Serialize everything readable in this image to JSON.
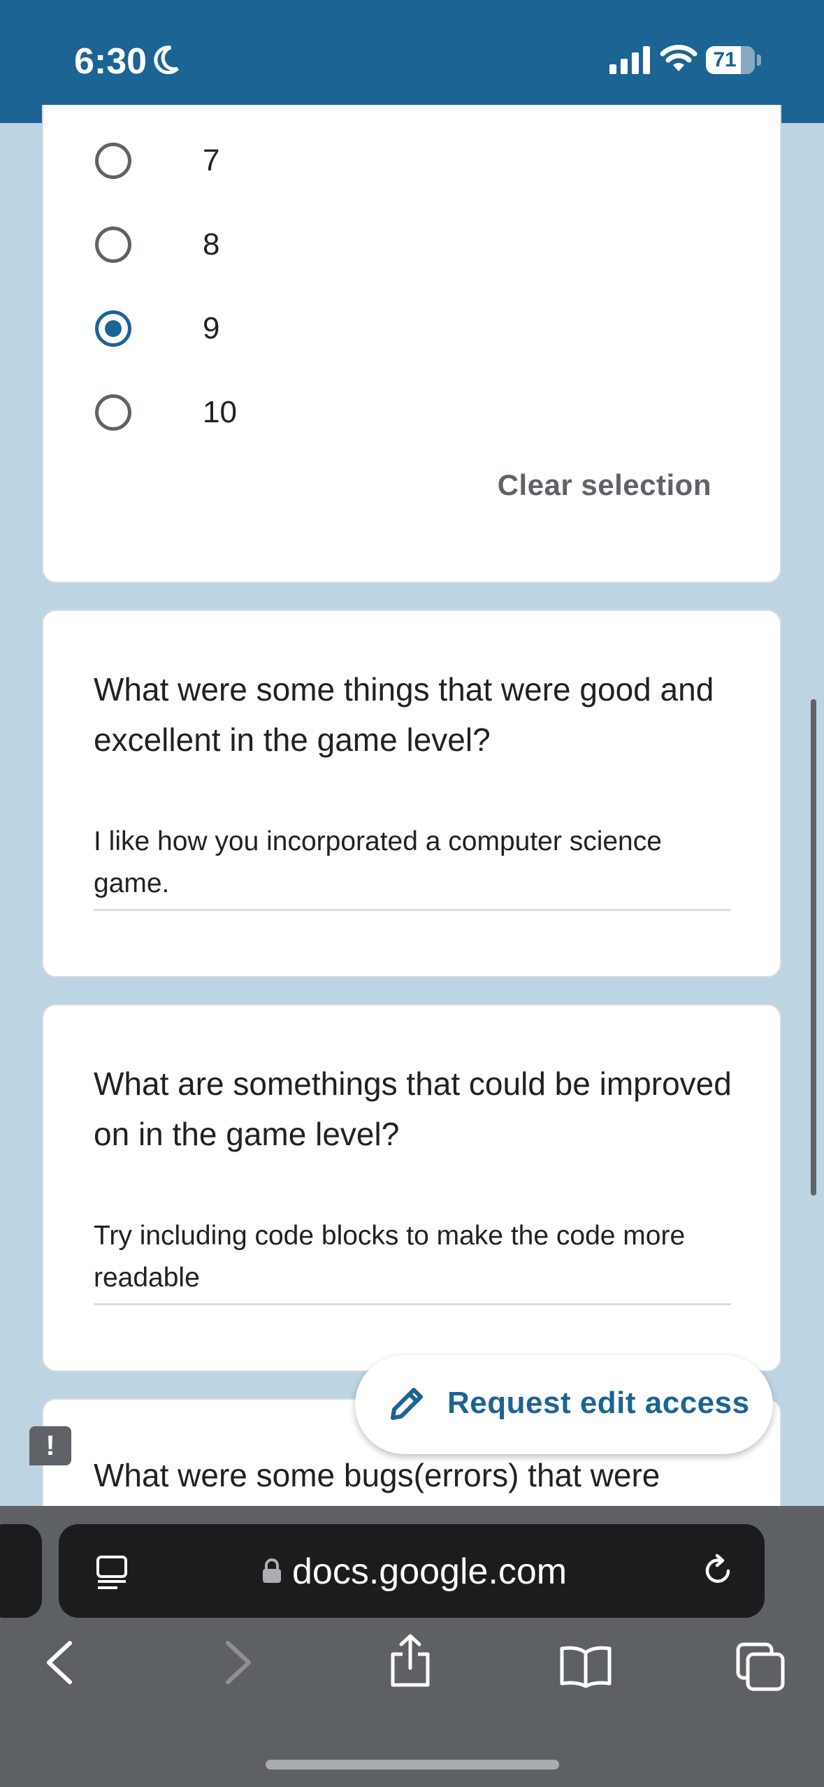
{
  "status_bar": {
    "time": "6:30",
    "battery": "71",
    "icons": [
      "moon-icon",
      "signal-icon",
      "wifi-icon",
      "battery-icon"
    ]
  },
  "rating_question": {
    "options": [
      "7",
      "8",
      "9",
      "10"
    ],
    "selected": "9",
    "clear_label": "Clear selection"
  },
  "questions": [
    {
      "question": "What were some things that were good and excellent in the game level?",
      "answer": "I like how you incorporated a computer science game."
    },
    {
      "question": "What are somethings that could be improved on in the game level?",
      "answer": "Try including code blocks to make the code more readable"
    },
    {
      "question": "What were some bugs(errors) that were"
    }
  ],
  "fab": {
    "label": "Request edit access",
    "icon": "pencil-icon"
  },
  "feedback_icon": "!",
  "browser": {
    "domain": "docs.google.com",
    "icons": [
      "reader-icon",
      "lock-icon",
      "reload-icon",
      "back-icon",
      "forward-icon",
      "share-icon",
      "bookmarks-icon",
      "tabs-icon"
    ]
  },
  "colors": {
    "header": "#1b6494",
    "background": "#bdd4e3",
    "accent": "#1b6494",
    "toolbar": "#5e6163"
  }
}
